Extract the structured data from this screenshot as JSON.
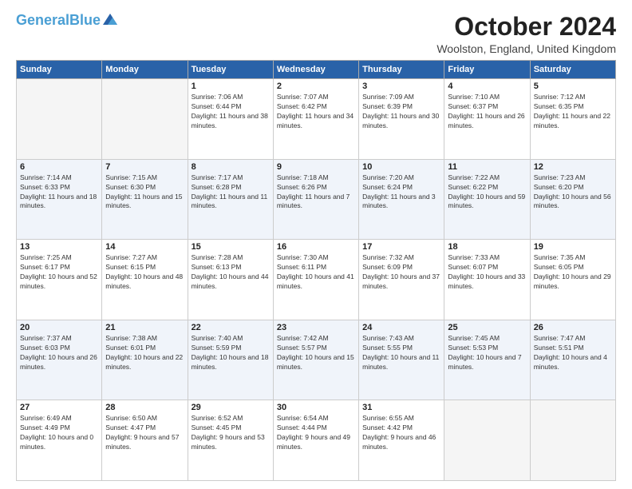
{
  "logo": {
    "name1": "General",
    "name2": "Blue"
  },
  "title": "October 2024",
  "location": "Woolston, England, United Kingdom",
  "days_header": [
    "Sunday",
    "Monday",
    "Tuesday",
    "Wednesday",
    "Thursday",
    "Friday",
    "Saturday"
  ],
  "weeks": [
    [
      {
        "day": "",
        "sunrise": "",
        "sunset": "",
        "daylight": "",
        "empty": true
      },
      {
        "day": "",
        "sunrise": "",
        "sunset": "",
        "daylight": "",
        "empty": true
      },
      {
        "day": "1",
        "sunrise": "Sunrise: 7:06 AM",
        "sunset": "Sunset: 6:44 PM",
        "daylight": "Daylight: 11 hours and 38 minutes."
      },
      {
        "day": "2",
        "sunrise": "Sunrise: 7:07 AM",
        "sunset": "Sunset: 6:42 PM",
        "daylight": "Daylight: 11 hours and 34 minutes."
      },
      {
        "day": "3",
        "sunrise": "Sunrise: 7:09 AM",
        "sunset": "Sunset: 6:39 PM",
        "daylight": "Daylight: 11 hours and 30 minutes."
      },
      {
        "day": "4",
        "sunrise": "Sunrise: 7:10 AM",
        "sunset": "Sunset: 6:37 PM",
        "daylight": "Daylight: 11 hours and 26 minutes."
      },
      {
        "day": "5",
        "sunrise": "Sunrise: 7:12 AM",
        "sunset": "Sunset: 6:35 PM",
        "daylight": "Daylight: 11 hours and 22 minutes."
      }
    ],
    [
      {
        "day": "6",
        "sunrise": "Sunrise: 7:14 AM",
        "sunset": "Sunset: 6:33 PM",
        "daylight": "Daylight: 11 hours and 18 minutes."
      },
      {
        "day": "7",
        "sunrise": "Sunrise: 7:15 AM",
        "sunset": "Sunset: 6:30 PM",
        "daylight": "Daylight: 11 hours and 15 minutes."
      },
      {
        "day": "8",
        "sunrise": "Sunrise: 7:17 AM",
        "sunset": "Sunset: 6:28 PM",
        "daylight": "Daylight: 11 hours and 11 minutes."
      },
      {
        "day": "9",
        "sunrise": "Sunrise: 7:18 AM",
        "sunset": "Sunset: 6:26 PM",
        "daylight": "Daylight: 11 hours and 7 minutes."
      },
      {
        "day": "10",
        "sunrise": "Sunrise: 7:20 AM",
        "sunset": "Sunset: 6:24 PM",
        "daylight": "Daylight: 11 hours and 3 minutes."
      },
      {
        "day": "11",
        "sunrise": "Sunrise: 7:22 AM",
        "sunset": "Sunset: 6:22 PM",
        "daylight": "Daylight: 10 hours and 59 minutes."
      },
      {
        "day": "12",
        "sunrise": "Sunrise: 7:23 AM",
        "sunset": "Sunset: 6:20 PM",
        "daylight": "Daylight: 10 hours and 56 minutes."
      }
    ],
    [
      {
        "day": "13",
        "sunrise": "Sunrise: 7:25 AM",
        "sunset": "Sunset: 6:17 PM",
        "daylight": "Daylight: 10 hours and 52 minutes."
      },
      {
        "day": "14",
        "sunrise": "Sunrise: 7:27 AM",
        "sunset": "Sunset: 6:15 PM",
        "daylight": "Daylight: 10 hours and 48 minutes."
      },
      {
        "day": "15",
        "sunrise": "Sunrise: 7:28 AM",
        "sunset": "Sunset: 6:13 PM",
        "daylight": "Daylight: 10 hours and 44 minutes."
      },
      {
        "day": "16",
        "sunrise": "Sunrise: 7:30 AM",
        "sunset": "Sunset: 6:11 PM",
        "daylight": "Daylight: 10 hours and 41 minutes."
      },
      {
        "day": "17",
        "sunrise": "Sunrise: 7:32 AM",
        "sunset": "Sunset: 6:09 PM",
        "daylight": "Daylight: 10 hours and 37 minutes."
      },
      {
        "day": "18",
        "sunrise": "Sunrise: 7:33 AM",
        "sunset": "Sunset: 6:07 PM",
        "daylight": "Daylight: 10 hours and 33 minutes."
      },
      {
        "day": "19",
        "sunrise": "Sunrise: 7:35 AM",
        "sunset": "Sunset: 6:05 PM",
        "daylight": "Daylight: 10 hours and 29 minutes."
      }
    ],
    [
      {
        "day": "20",
        "sunrise": "Sunrise: 7:37 AM",
        "sunset": "Sunset: 6:03 PM",
        "daylight": "Daylight: 10 hours and 26 minutes."
      },
      {
        "day": "21",
        "sunrise": "Sunrise: 7:38 AM",
        "sunset": "Sunset: 6:01 PM",
        "daylight": "Daylight: 10 hours and 22 minutes."
      },
      {
        "day": "22",
        "sunrise": "Sunrise: 7:40 AM",
        "sunset": "Sunset: 5:59 PM",
        "daylight": "Daylight: 10 hours and 18 minutes."
      },
      {
        "day": "23",
        "sunrise": "Sunrise: 7:42 AM",
        "sunset": "Sunset: 5:57 PM",
        "daylight": "Daylight: 10 hours and 15 minutes."
      },
      {
        "day": "24",
        "sunrise": "Sunrise: 7:43 AM",
        "sunset": "Sunset: 5:55 PM",
        "daylight": "Daylight: 10 hours and 11 minutes."
      },
      {
        "day": "25",
        "sunrise": "Sunrise: 7:45 AM",
        "sunset": "Sunset: 5:53 PM",
        "daylight": "Daylight: 10 hours and 7 minutes."
      },
      {
        "day": "26",
        "sunrise": "Sunrise: 7:47 AM",
        "sunset": "Sunset: 5:51 PM",
        "daylight": "Daylight: 10 hours and 4 minutes."
      }
    ],
    [
      {
        "day": "27",
        "sunrise": "Sunrise: 6:49 AM",
        "sunset": "Sunset: 4:49 PM",
        "daylight": "Daylight: 10 hours and 0 minutes."
      },
      {
        "day": "28",
        "sunrise": "Sunrise: 6:50 AM",
        "sunset": "Sunset: 4:47 PM",
        "daylight": "Daylight: 9 hours and 57 minutes."
      },
      {
        "day": "29",
        "sunrise": "Sunrise: 6:52 AM",
        "sunset": "Sunset: 4:45 PM",
        "daylight": "Daylight: 9 hours and 53 minutes."
      },
      {
        "day": "30",
        "sunrise": "Sunrise: 6:54 AM",
        "sunset": "Sunset: 4:44 PM",
        "daylight": "Daylight: 9 hours and 49 minutes."
      },
      {
        "day": "31",
        "sunrise": "Sunrise: 6:55 AM",
        "sunset": "Sunset: 4:42 PM",
        "daylight": "Daylight: 9 hours and 46 minutes."
      },
      {
        "day": "",
        "sunrise": "",
        "sunset": "",
        "daylight": "",
        "empty": true
      },
      {
        "day": "",
        "sunrise": "",
        "sunset": "",
        "daylight": "",
        "empty": true
      }
    ]
  ]
}
